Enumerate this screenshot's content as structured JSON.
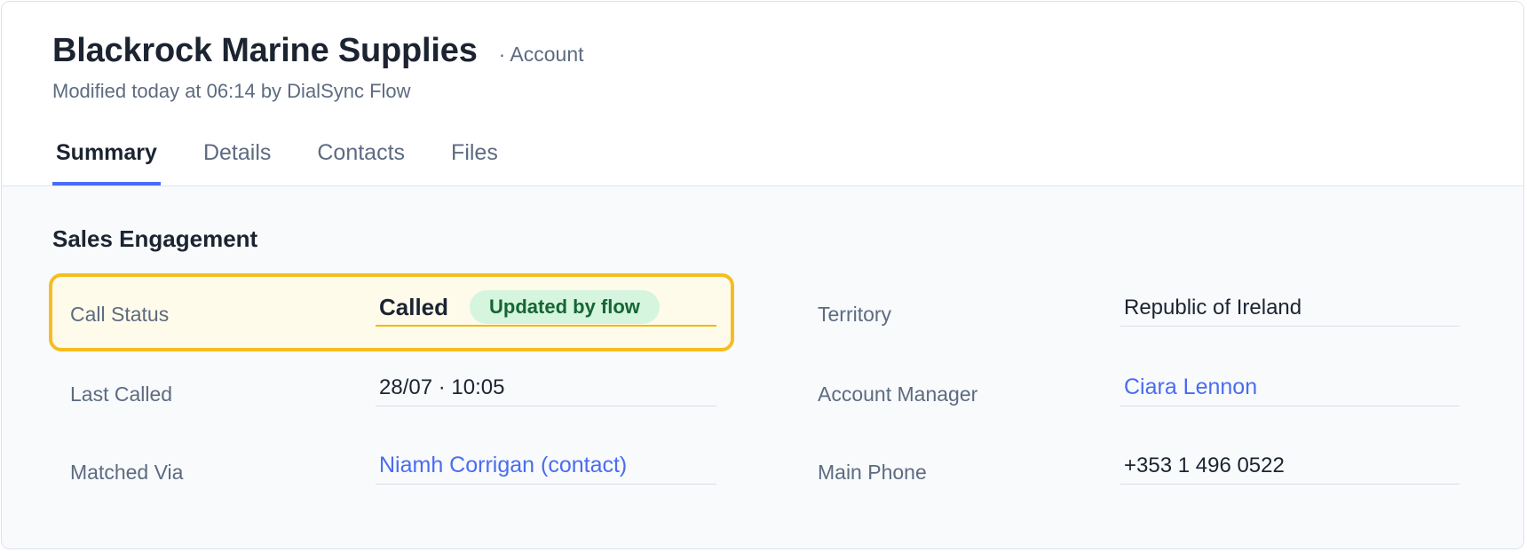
{
  "record": {
    "name": "Blackrock Marine Supplies",
    "type": "· Account",
    "modified": "Modified today at 06:14 by DialSync Flow"
  },
  "tabs": [
    {
      "label": "Summary",
      "active": true
    },
    {
      "label": "Details",
      "active": false
    },
    {
      "label": "Contacts",
      "active": false
    },
    {
      "label": "Files",
      "active": false
    }
  ],
  "section": {
    "title": "Sales Engagement",
    "fields": {
      "call_status": {
        "label": "Call Status",
        "value": "Called",
        "badge": "Updated by flow",
        "highlighted": true
      },
      "last_called": {
        "label": "Last Called",
        "value": "28/07 · 10:05"
      },
      "matched_via": {
        "label": "Matched Via",
        "value": "Niamh Corrigan (contact)",
        "is_link": true
      },
      "territory": {
        "label": "Territory",
        "value": "Republic of Ireland"
      },
      "account_manager": {
        "label": "Account Manager",
        "value": "Ciara Lennon",
        "is_link": true
      },
      "main_phone": {
        "label": "Main Phone",
        "value": "+353 1 496 0522"
      }
    }
  },
  "colors": {
    "accent": "#4a6cf7",
    "highlight_border": "#f5bd1f",
    "highlight_bg": "#fffbeb",
    "badge_bg": "#d5f5df",
    "badge_text": "#166534",
    "link": "#4a6cf0"
  }
}
